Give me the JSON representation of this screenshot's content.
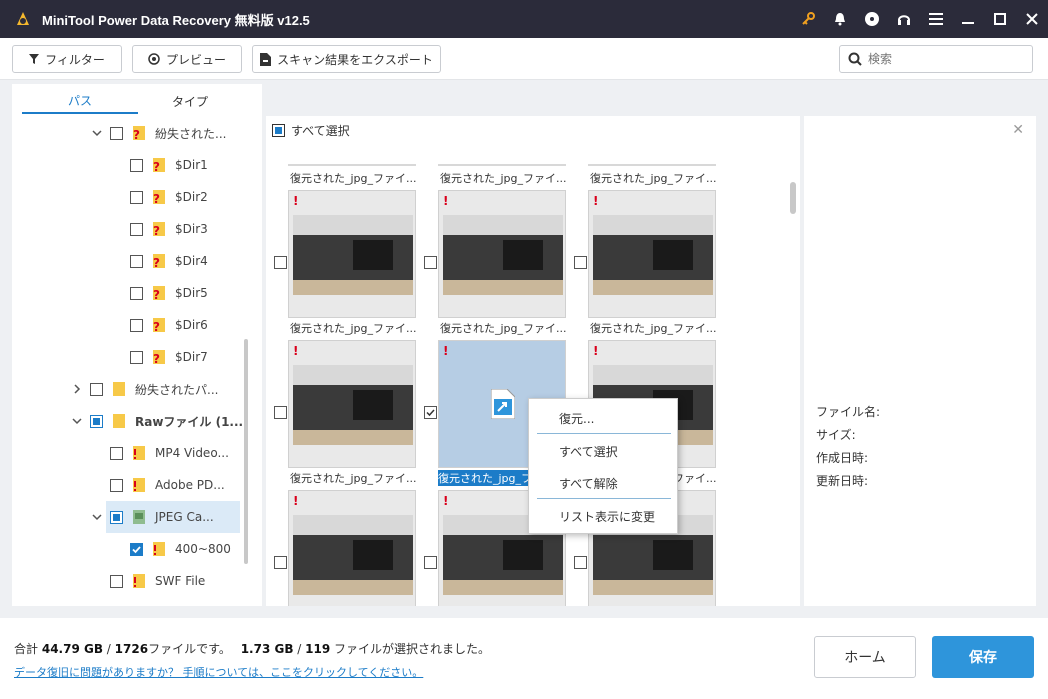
{
  "window": {
    "title": "MiniTool Power Data Recovery 無料版 v12.5"
  },
  "titlebar_icons": [
    "key-icon",
    "bell-icon",
    "disc-icon",
    "headset-icon",
    "menu-icon",
    "minimize-icon",
    "maximize-icon",
    "close-icon"
  ],
  "toolbar": {
    "filter_label": "フィルター",
    "preview_label": "プレビュー",
    "export_label": "スキャン結果をエクスポート",
    "search_placeholder": "検索"
  },
  "left_tabs": {
    "path": "パス",
    "type": "タイプ"
  },
  "tree": [
    {
      "label": "紛失された...",
      "arrow": "down",
      "bold": false,
      "icon": "folder-q"
    },
    {
      "label": "$Dir1",
      "icon": "folder-q"
    },
    {
      "label": "$Dir2",
      "icon": "folder-q"
    },
    {
      "label": "$Dir3",
      "icon": "folder-q"
    },
    {
      "label": "$Dir4",
      "icon": "folder-q"
    },
    {
      "label": "$Dir5",
      "icon": "folder-q"
    },
    {
      "label": "$Dir6",
      "icon": "folder-q"
    },
    {
      "label": "$Dir7",
      "icon": "folder-q"
    },
    {
      "label": "紛失されたパ...",
      "icon": "folder"
    },
    {
      "label": "Rawファイル (1...",
      "icon": "folder"
    },
    {
      "label": "MP4 Video...",
      "icon": "folder-ex"
    },
    {
      "label": "Adobe PD...",
      "icon": "folder-ex"
    },
    {
      "label": "JPEG Ca...",
      "icon": "folder-img"
    },
    {
      "label": "400~800",
      "icon": "folder-ex"
    },
    {
      "label": "SWF File",
      "icon": "folder-ex"
    }
  ],
  "grid": {
    "select_all": "すべて選択",
    "file_name": "復元された_jpg_ファイ...",
    "selected_file_name": "復元された_jpg_フ..."
  },
  "context_menu": {
    "recover": "復元...",
    "select_all": "すべて選択",
    "deselect_all": "すべて解除",
    "list_view": "リスト表示に変更"
  },
  "info_panel": {
    "filename": "ファイル名:",
    "size": "サイズ:",
    "created": "作成日時:",
    "modified": "更新日時:"
  },
  "footer": {
    "summary_prefix": "合計",
    "total_size": "44.79 GB",
    "total_files": "1726",
    "files_text": "ファイルです。",
    "selected_size": "1.73 GB",
    "selected_files": "119",
    "selected_text": "ファイルが選択されました。",
    "help_link": "データ復旧に問題がありますか？ 手順については、ここをクリックしてください。",
    "home_button": "ホーム",
    "save_button": "保存"
  }
}
